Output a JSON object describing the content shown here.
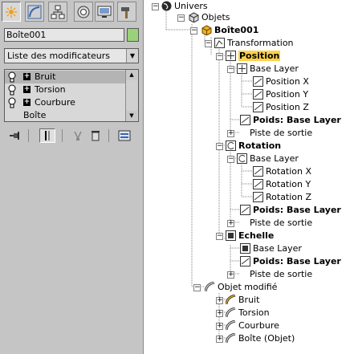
{
  "left_panel": {
    "tabs": [
      {
        "icon": "create-icon",
        "active": true
      },
      {
        "icon": "modify-icon",
        "active": false
      },
      {
        "icon": "hierarchy-icon",
        "active": false
      },
      {
        "icon": "motion-icon",
        "active": false
      },
      {
        "icon": "display-icon",
        "active": false
      },
      {
        "icon": "utilities-icon",
        "active": false
      }
    ],
    "object_name": "Boîte001",
    "object_color": "#9ad27a",
    "modifier_list_label": "Liste des modificateurs",
    "stack": [
      {
        "label": "Bruit",
        "selected": true
      },
      {
        "label": "Torsion",
        "selected": false
      },
      {
        "label": "Courbure",
        "selected": false
      },
      {
        "label": "Boîte",
        "selected": false
      }
    ],
    "stack_tools": [
      "pin-stack-icon",
      "show-end-result-icon",
      "make-unique-icon",
      "remove-modifier-icon",
      "configure-sets-icon"
    ]
  },
  "tree": {
    "nodes": [
      {
        "label": "Univers",
        "icon": "world-icon"
      },
      {
        "label": "Objets",
        "icon": "objects-icon"
      },
      {
        "label": "Boîte001",
        "icon": "box-object-icon"
      },
      {
        "label": "Transformation",
        "icon": "transform-controller-icon"
      },
      {
        "label": "Position",
        "icon": "position-controller-icon"
      },
      {
        "label": "Base Layer",
        "icon": "position-controller-icon"
      },
      {
        "label": "Position X",
        "icon": "curve-icon"
      },
      {
        "label": "Position Y",
        "icon": "curve-icon"
      },
      {
        "label": "Position Z",
        "icon": "curve-icon"
      },
      {
        "label": "Poids: Base Layer",
        "icon": "curve-icon"
      },
      {
        "label": "Piste de sortie",
        "icon": ""
      },
      {
        "label": "Rotation",
        "icon": "rotation-controller-icon"
      },
      {
        "label": "Base Layer",
        "icon": "rotation-controller-icon"
      },
      {
        "label": "Rotation X",
        "icon": "curve-icon"
      },
      {
        "label": "Rotation Y",
        "icon": "curve-icon"
      },
      {
        "label": "Rotation Z",
        "icon": "curve-icon"
      },
      {
        "label": "Poids: Base Layer",
        "icon": "curve-icon"
      },
      {
        "label": "Piste de sortie",
        "icon": ""
      },
      {
        "label": "Echelle",
        "icon": "scale-controller-icon"
      },
      {
        "label": "Base Layer",
        "icon": "scale-controller-icon"
      },
      {
        "label": "Poids: Base Layer",
        "icon": "curve-icon"
      },
      {
        "label": "Piste de sortie",
        "icon": ""
      },
      {
        "label": "Objet modifié",
        "icon": "modified-object-icon"
      },
      {
        "label": "Bruit",
        "icon": "modifier-icon"
      },
      {
        "label": "Torsion",
        "icon": "modifier-icon"
      },
      {
        "label": "Courbure",
        "icon": "modifier-icon"
      },
      {
        "label": "Boîte (Objet)",
        "icon": "modifier-icon"
      }
    ]
  }
}
